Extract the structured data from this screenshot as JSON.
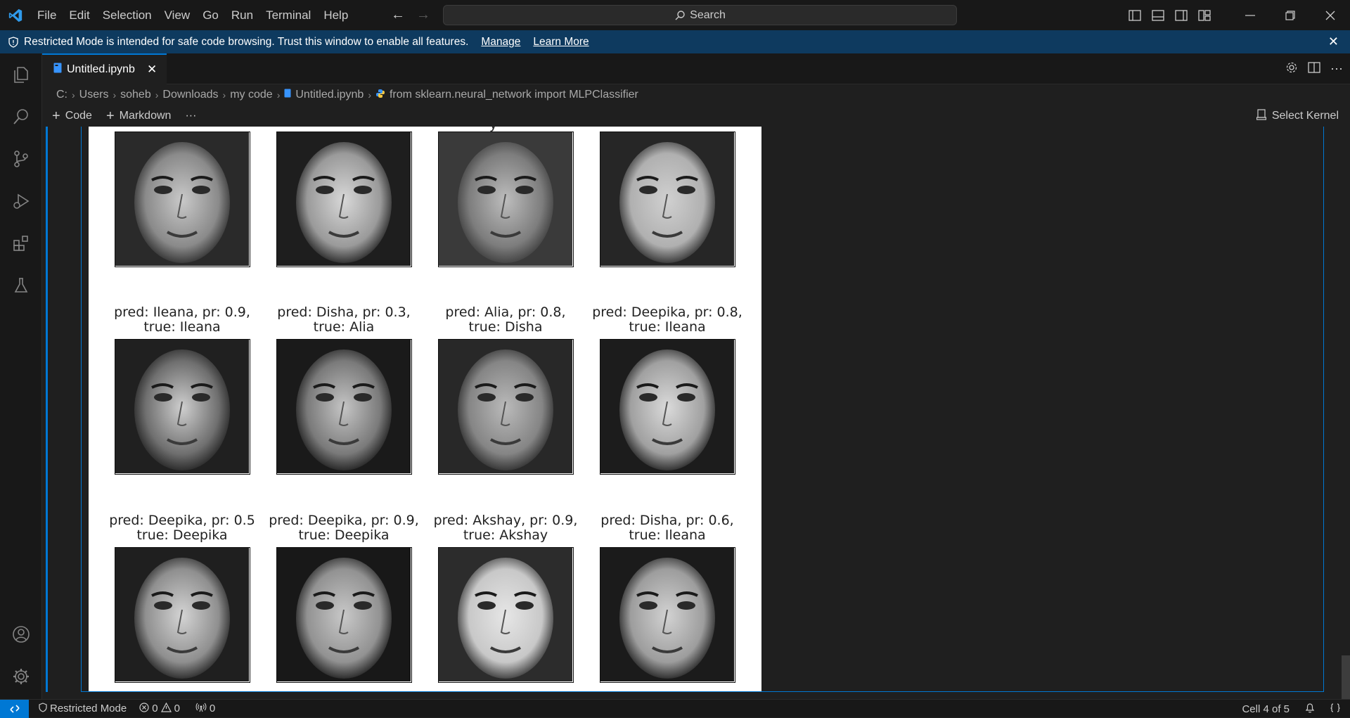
{
  "menu": [
    "File",
    "Edit",
    "Selection",
    "View",
    "Go",
    "Run",
    "Terminal",
    "Help"
  ],
  "search": {
    "placeholder": "Search"
  },
  "banner": {
    "message": "Restricted Mode is intended for safe code browsing. Trust this window to enable all features.",
    "manage": "Manage",
    "learn_more": "Learn More"
  },
  "tab": {
    "label": "Untitled.ipynb"
  },
  "breadcrumb": [
    "C:",
    "Users",
    "soheb",
    "Downloads",
    "my code",
    "Untitled.ipynb",
    "from sklearn.neural_network import MLPClassifier"
  ],
  "toolbar": {
    "code": "Code",
    "markdown": "Markdown",
    "more": "···",
    "kernel": "Select Kernel"
  },
  "gallery": {
    "rows": [
      {
        "cells": [
          {
            "caption1": "",
            "caption2": ""
          },
          {
            "caption1": "",
            "caption2": ""
          },
          {
            "caption1": "",
            "caption2": ""
          },
          {
            "caption1": "",
            "caption2": ""
          }
        ]
      },
      {
        "cells": [
          {
            "caption1": "pred: Ileana, pr: 0.9,",
            "caption2": "true: Ileana"
          },
          {
            "caption1": "pred: Disha, pr: 0.3,",
            "caption2": "true: Alia"
          },
          {
            "caption1": "pred: Alia, pr: 0.8,",
            "caption2": "true: Disha"
          },
          {
            "caption1": "pred: Deepika, pr: 0.8,",
            "caption2": "true: Ileana"
          }
        ]
      },
      {
        "cells": [
          {
            "caption1": "pred: Deepika, pr: 0.5",
            "caption2": "true: Deepika"
          },
          {
            "caption1": "pred: Deepika, pr: 0.9,",
            "caption2": "true: Deepika"
          },
          {
            "caption1": "pred: Akshay, pr: 0.9,",
            "caption2": "true: Akshay"
          },
          {
            "caption1": "pred: Disha, pr: 0.6,",
            "caption2": "true: Ileana"
          }
        ]
      }
    ]
  },
  "status": {
    "restricted": "Restricted Mode",
    "errors": "0",
    "warnings": "0",
    "ports": "0",
    "cell_pos": "Cell 4 of 5"
  },
  "colors": {
    "accent": "#0078d4",
    "banner": "#0e3a5f"
  }
}
